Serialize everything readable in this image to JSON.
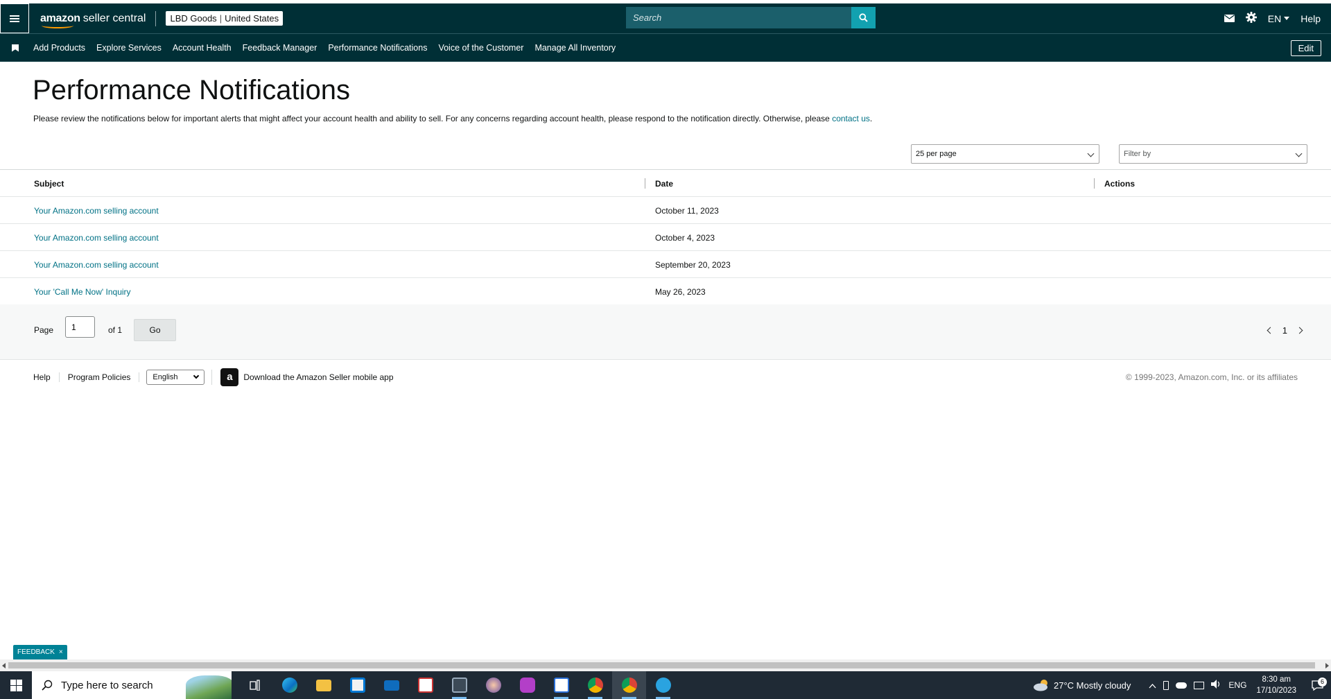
{
  "header": {
    "logo_brand": "amazon",
    "logo_product": "seller central",
    "store_name": "LBD Goods",
    "store_region": "United States",
    "search_placeholder": "Search",
    "language": "EN",
    "help": "Help",
    "icons": [
      "menu-icon",
      "search-icon",
      "mail-icon",
      "gear-icon"
    ]
  },
  "nav": {
    "items": [
      "Add Products",
      "Explore Services",
      "Account Health",
      "Feedback Manager",
      "Performance Notifications",
      "Voice of the Customer",
      "Manage All Inventory"
    ],
    "edit": "Edit"
  },
  "main": {
    "title": "Performance Notifications",
    "intro_text": "Please review the notifications below for important alerts that might affect your account health and ability to sell. For any concerns regarding account health, please respond to the notification directly. Otherwise, please",
    "intro_link": "contact us",
    "intro_end": ".",
    "per_page": "25 per page",
    "filter_placeholder": "Filter by"
  },
  "table": {
    "columns": [
      "Subject",
      "Date",
      "Actions"
    ],
    "rows": [
      {
        "subject": "Your Amazon.com selling account",
        "date": "October 11, 2023"
      },
      {
        "subject": "Your Amazon.com selling account",
        "date": "October 4, 2023"
      },
      {
        "subject": "Your Amazon.com selling account",
        "date": "September 20, 2023"
      },
      {
        "subject": "Your 'Call Me Now' Inquiry",
        "date": "May 26, 2023"
      }
    ]
  },
  "pager": {
    "label": "Page",
    "current": "1",
    "of": "of 1",
    "go": "Go",
    "nav_page": "1"
  },
  "footer": {
    "help": "Help",
    "policies": "Program Policies",
    "language": "English",
    "app_icon_letter": "a",
    "app_text": "Download the Amazon Seller mobile app",
    "copyright": "© 1999-2023, Amazon.com, Inc. or its affiliates"
  },
  "feedback": {
    "label": "FEEDBACK",
    "close": "×"
  },
  "taskbar": {
    "search_placeholder": "Type here to search",
    "weather": "27°C  Mostly cloudy",
    "lang": "ENG",
    "time": "8:30 am",
    "date": "17/10/2023",
    "notification_count": "6"
  }
}
